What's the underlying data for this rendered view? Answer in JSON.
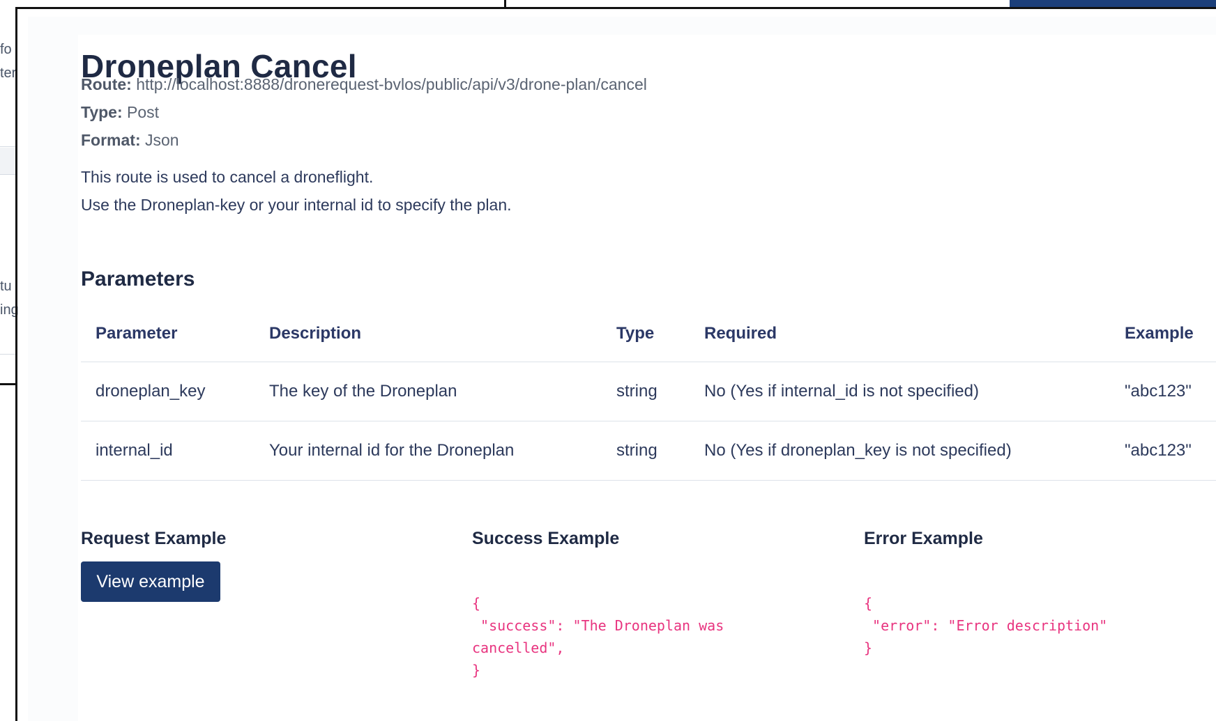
{
  "background_fragments": {
    "frag1": "fo",
    "frag2": "ter",
    "frag3": "tu",
    "frag4": "ing"
  },
  "page": {
    "title": "Droneplan Cancel",
    "route_label": "Route:",
    "route_value": "http://localhost:8888/dronerequest-bvlos/public/api/v3/drone-plan/cancel",
    "type_label": "Type:",
    "type_value": "Post",
    "format_label": "Format:",
    "format_value": "Json",
    "description_line1": "This route is used to cancel a droneflight.",
    "description_line2": "Use the Droneplan-key or your internal id to specify the plan."
  },
  "parameters": {
    "title": "Parameters",
    "headers": [
      "Parameter",
      "Description",
      "Type",
      "Required",
      "Example"
    ],
    "rows": [
      [
        "droneplan_key",
        "The key of the Droneplan",
        "string",
        "No (Yes if internal_id is not specified)",
        "\"abc123\""
      ],
      [
        "internal_id",
        "Your internal id for the Droneplan",
        "string",
        "No (Yes if droneplan_key is not specified)",
        "\"abc123\""
      ]
    ]
  },
  "examples": {
    "request_title": "Request Example",
    "view_button": "View example",
    "success_title": "Success Example",
    "success_code": "{\n \"success\": \"The Droneplan was\ncancelled\",\n}",
    "error_title": "Error Example",
    "error_code": "{\n \"error\": \"Error description\"\n}"
  },
  "colors": {
    "heading": "#1f2a44",
    "button_bg": "#1c3a6e",
    "code_text": "#e8347f",
    "accent_tab": "#1c3f7a"
  }
}
